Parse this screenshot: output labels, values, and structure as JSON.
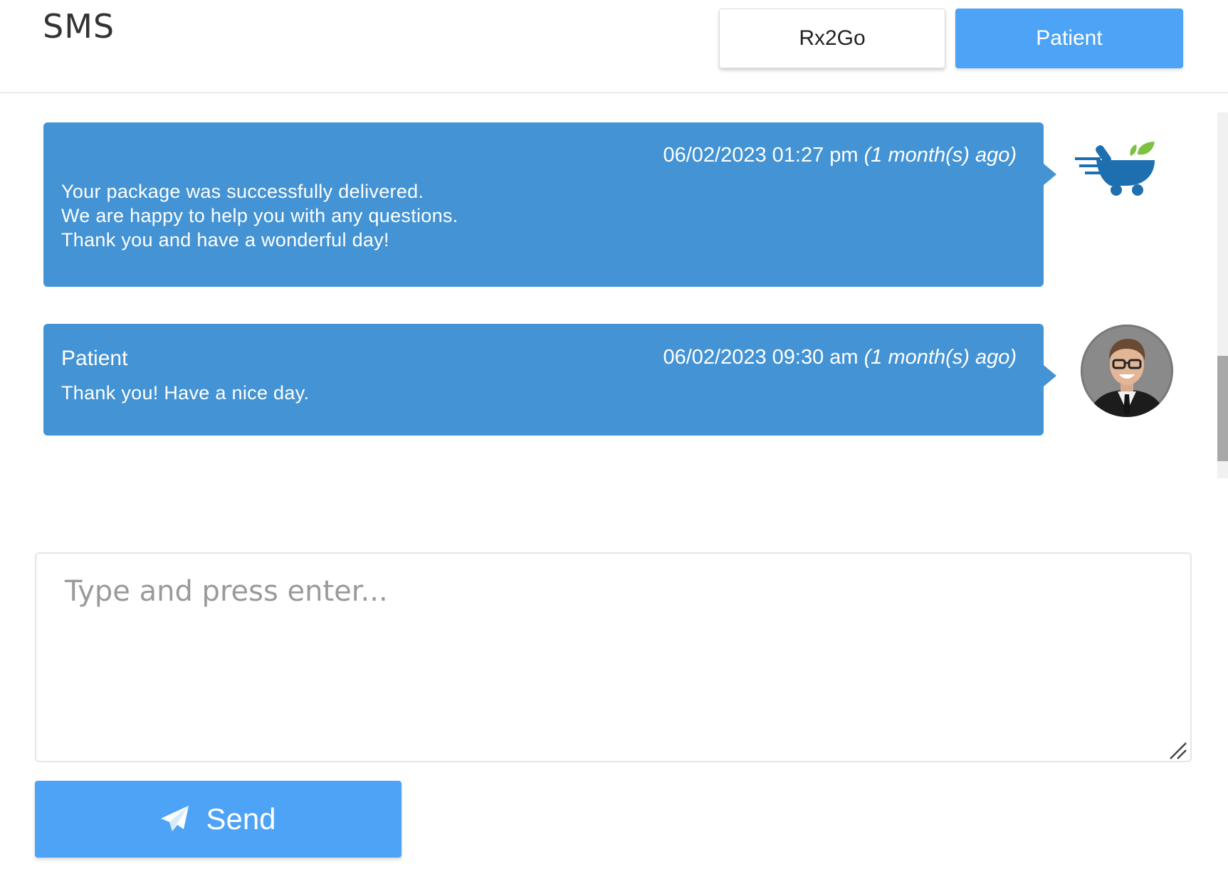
{
  "header": {
    "title": "SMS",
    "tabs": [
      {
        "label": "Rx2Go",
        "active": false
      },
      {
        "label": "Patient",
        "active": true
      }
    ]
  },
  "messages": [
    {
      "sender": "",
      "timestamp": "06/02/2023 01:27 pm",
      "relative": "(1 month(s) ago)",
      "body": "Your package was successfully delivered.\nWe are happy to help you with any questions.\nThank you and have a wonderful day!",
      "avatar": "pharmacy-logo-icon"
    },
    {
      "sender": "Patient",
      "timestamp": "06/02/2023 09:30 am",
      "relative": "(1 month(s) ago)",
      "body": "Thank you! Have a nice day.",
      "avatar": "patient-avatar"
    }
  ],
  "composer": {
    "placeholder": "Type and press enter..."
  },
  "send_button": {
    "label": "Send",
    "icon": "paper-plane-icon"
  },
  "colors": {
    "accent": "#4da3f5",
    "bubble": "#4493d4"
  }
}
